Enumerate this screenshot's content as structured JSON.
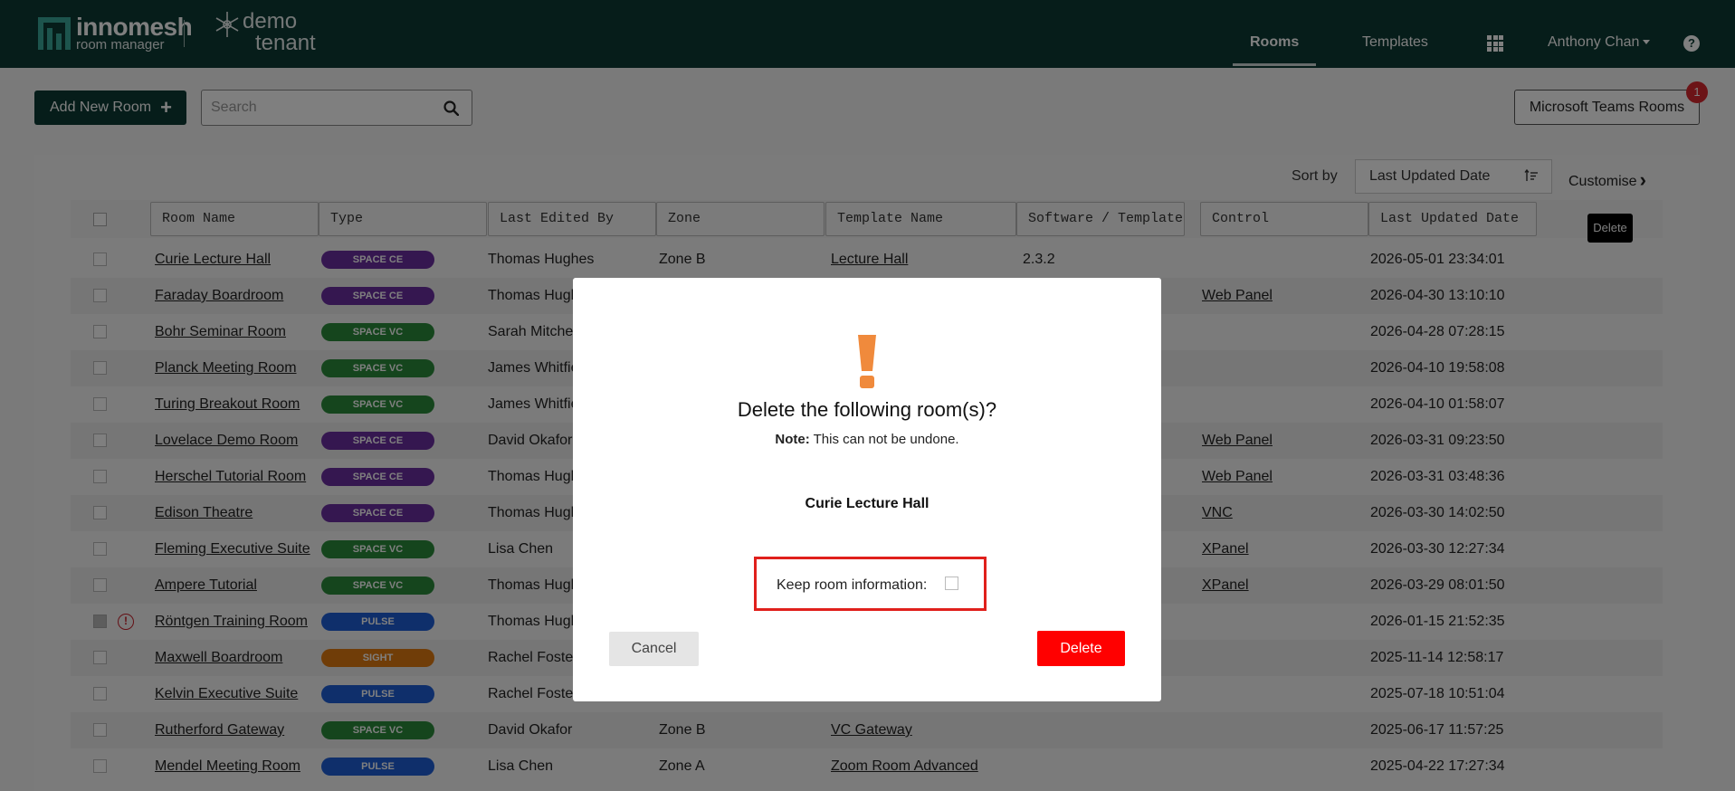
{
  "header": {
    "brand": "innomesh",
    "brand_sub": "room manager",
    "tenant_line1": "demo",
    "tenant_line2": "tenant",
    "nav_rooms": "Rooms",
    "nav_templates": "Templates",
    "user_name": "Anthony Chan",
    "help": "?"
  },
  "toolbar": {
    "add_label": "Add New Room",
    "search_placeholder": "Search",
    "ms_teams_label": "Microsoft Teams Rooms",
    "ms_teams_badge": "1"
  },
  "sort": {
    "label": "Sort by",
    "value": "Last Updated Date",
    "customise": "Customise"
  },
  "table": {
    "columns": [
      "Room Name",
      "Type",
      "Last Edited By",
      "Zone",
      "Template Name",
      "Software / Template",
      "Control",
      "Last Updated Date"
    ],
    "delete_tooltip": "Delete",
    "rows": [
      {
        "name": "Curie Lecture Hall",
        "type": "SPACE CE",
        "type_color": "#6b2fa0",
        "editor": "Thomas Hughes",
        "zone": "Zone B",
        "template": "Lecture Hall",
        "software": "2.3.2",
        "control": "",
        "updated": "2026-05-01 23:34:01"
      },
      {
        "name": "Faraday Boardroom",
        "type": "SPACE CE",
        "type_color": "#6b2fa0",
        "editor": "Thomas Hughes",
        "zone": "",
        "template": "",
        "software": "",
        "control": "Web Panel",
        "updated": "2026-04-30 13:10:10"
      },
      {
        "name": "Bohr Seminar Room",
        "type": "SPACE VC",
        "type_color": "#2a8a3a",
        "editor": "Sarah Mitchell",
        "zone": "",
        "template": "",
        "software": "",
        "control": "",
        "updated": "2026-04-28 07:28:15"
      },
      {
        "name": "Planck Meeting Room",
        "type": "SPACE VC",
        "type_color": "#2a8a3a",
        "editor": "James Whitfield",
        "zone": "",
        "template": "",
        "software": "",
        "control": "",
        "updated": "2026-04-10 19:58:08"
      },
      {
        "name": "Turing Breakout Room",
        "type": "SPACE VC",
        "type_color": "#2a8a3a",
        "editor": "James Whitfield",
        "zone": "",
        "template": "",
        "software": "",
        "control": "",
        "updated": "2026-04-10 01:58:07"
      },
      {
        "name": "Lovelace Demo Room",
        "type": "SPACE CE",
        "type_color": "#6b2fa0",
        "editor": "David Okafor",
        "zone": "",
        "template": "",
        "software": "",
        "control": "Web Panel",
        "updated": "2026-03-31 09:23:50"
      },
      {
        "name": "Herschel Tutorial Room",
        "type": "SPACE CE",
        "type_color": "#6b2fa0",
        "editor": "Thomas Hughes",
        "zone": "",
        "template": "",
        "software": "",
        "control": "Web Panel",
        "updated": "2026-03-31 03:48:36"
      },
      {
        "name": "Edison Theatre",
        "type": "SPACE CE",
        "type_color": "#6b2fa0",
        "editor": "Thomas Hughes",
        "zone": "",
        "template": "",
        "software": "",
        "control": "VNC",
        "updated": "2026-03-30 14:02:50"
      },
      {
        "name": "Fleming Executive Suite",
        "type": "SPACE VC",
        "type_color": "#2a8a3a",
        "editor": "Lisa Chen",
        "zone": "",
        "template": "",
        "software": "",
        "control": "XPanel",
        "updated": "2026-03-30 12:27:34"
      },
      {
        "name": "Ampere Tutorial",
        "type": "SPACE VC",
        "type_color": "#2a8a3a",
        "editor": "Thomas Hughes",
        "zone": "",
        "template": "",
        "software": "",
        "control": "XPanel",
        "updated": "2026-03-29 08:01:50"
      },
      {
        "name": "Röntgen Training Room",
        "type": "PULSE",
        "type_color": "#1f5fd6",
        "editor": "Thomas Hughes",
        "zone": "",
        "template": "",
        "software": "",
        "control": "",
        "updated": "2026-01-15 21:52:35",
        "warn": "!"
      },
      {
        "name": "Maxwell Boardroom",
        "type": "SIGHT",
        "type_color": "#e07a10",
        "editor": "Rachel Foster",
        "zone": "",
        "template": "",
        "software": "",
        "control": "",
        "updated": "2025-11-14 12:58:17"
      },
      {
        "name": "Kelvin Executive Suite",
        "type": "PULSE",
        "type_color": "#1f5fd6",
        "editor": "Rachel Foster",
        "zone": "",
        "template": "",
        "software": "",
        "control": "",
        "updated": "2025-07-18 10:51:04"
      },
      {
        "name": "Rutherford Gateway",
        "type": "SPACE VC",
        "type_color": "#2a8a3a",
        "editor": "David Okafor",
        "zone": "Zone B",
        "template": "VC Gateway",
        "software": "",
        "control": "",
        "updated": "2025-06-17 11:57:25"
      },
      {
        "name": "Mendel Meeting Room",
        "type": "PULSE",
        "type_color": "#1f5fd6",
        "editor": "Lisa Chen",
        "zone": "Zone A",
        "template": "Zoom Room Advanced",
        "software": "",
        "control": "",
        "updated": "2025-04-22 17:27:34"
      }
    ]
  },
  "modal": {
    "title": "Delete the following room(s)?",
    "note_bold": "Note:",
    "note_text": " This can not be undone.",
    "room": "Curie Lecture Hall",
    "keep_label": "Keep room information:",
    "cancel_label": "Cancel",
    "delete_label": "Delete",
    "accent_color": "#f08a3c"
  }
}
